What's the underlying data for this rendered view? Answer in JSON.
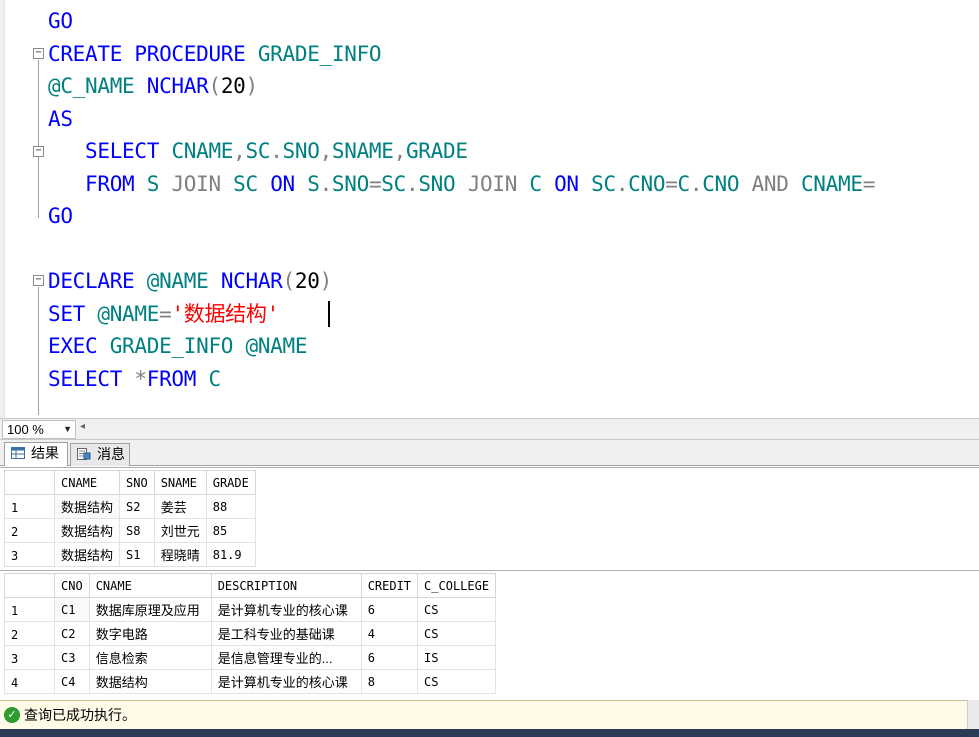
{
  "editor": {
    "lines": [
      {
        "tokens": [
          {
            "t": "GO",
            "c": "kw"
          }
        ]
      },
      {
        "tokens": [
          {
            "t": "CREATE PROCEDURE ",
            "c": "kw"
          },
          {
            "t": "GRADE_INFO",
            "c": "ob"
          }
        ]
      },
      {
        "tokens": [
          {
            "t": "@C_NAME ",
            "c": "var"
          },
          {
            "t": "NCHAR",
            "c": "kw"
          },
          {
            "t": "(",
            "c": "gy"
          },
          {
            "t": "20",
            "c": "bk"
          },
          {
            "t": ")",
            "c": "gy"
          }
        ]
      },
      {
        "tokens": [
          {
            "t": "AS",
            "c": "kw"
          }
        ]
      },
      {
        "tokens": [
          {
            "t": "   SELECT ",
            "c": "kw"
          },
          {
            "t": "CNAME",
            "c": "ob"
          },
          {
            "t": ",",
            "c": "gy"
          },
          {
            "t": "SC",
            "c": "ob"
          },
          {
            "t": ".",
            "c": "gy"
          },
          {
            "t": "SNO",
            "c": "ob"
          },
          {
            "t": ",",
            "c": "gy"
          },
          {
            "t": "SNAME",
            "c": "ob"
          },
          {
            "t": ",",
            "c": "gy"
          },
          {
            "t": "GRADE",
            "c": "ob"
          }
        ]
      },
      {
        "tokens": [
          {
            "t": "   FROM ",
            "c": "kw"
          },
          {
            "t": "S ",
            "c": "ob"
          },
          {
            "t": "JOIN ",
            "c": "gy"
          },
          {
            "t": "SC ",
            "c": "ob"
          },
          {
            "t": "ON ",
            "c": "kw"
          },
          {
            "t": "S",
            "c": "ob"
          },
          {
            "t": ".",
            "c": "gy"
          },
          {
            "t": "SNO",
            "c": "ob"
          },
          {
            "t": "=",
            "c": "gy"
          },
          {
            "t": "SC",
            "c": "ob"
          },
          {
            "t": ".",
            "c": "gy"
          },
          {
            "t": "SNO ",
            "c": "ob"
          },
          {
            "t": "JOIN ",
            "c": "gy"
          },
          {
            "t": "C ",
            "c": "ob"
          },
          {
            "t": "ON ",
            "c": "kw"
          },
          {
            "t": "SC",
            "c": "ob"
          },
          {
            "t": ".",
            "c": "gy"
          },
          {
            "t": "CNO",
            "c": "ob"
          },
          {
            "t": "=",
            "c": "gy"
          },
          {
            "t": "C",
            "c": "ob"
          },
          {
            "t": ".",
            "c": "gy"
          },
          {
            "t": "CNO ",
            "c": "ob"
          },
          {
            "t": "AND ",
            "c": "gy"
          },
          {
            "t": "CNAME",
            "c": "ob"
          },
          {
            "t": "=",
            "c": "gy"
          }
        ]
      },
      {
        "tokens": [
          {
            "t": "GO",
            "c": "kw"
          }
        ]
      },
      {
        "tokens": []
      },
      {
        "tokens": [
          {
            "t": "DECLARE ",
            "c": "kw"
          },
          {
            "t": "@NAME ",
            "c": "var"
          },
          {
            "t": "NCHAR",
            "c": "kw"
          },
          {
            "t": "(",
            "c": "gy"
          },
          {
            "t": "20",
            "c": "bk"
          },
          {
            "t": ")",
            "c": "gy"
          }
        ]
      },
      {
        "tokens": [
          {
            "t": "SET ",
            "c": "kw"
          },
          {
            "t": "@NAME",
            "c": "var"
          },
          {
            "t": "=",
            "c": "gy"
          },
          {
            "t": "'数据结构'",
            "c": "str"
          }
        ]
      },
      {
        "tokens": [
          {
            "t": "EXEC ",
            "c": "kw"
          },
          {
            "t": "GRADE_INFO ",
            "c": "ob"
          },
          {
            "t": "@NAME",
            "c": "var"
          }
        ]
      },
      {
        "tokens": [
          {
            "t": "SELECT ",
            "c": "kw"
          },
          {
            "t": "*",
            "c": "gy"
          },
          {
            "t": "FROM ",
            "c": "kw"
          },
          {
            "t": "C",
            "c": "ob"
          }
        ]
      }
    ]
  },
  "zoom": {
    "value": "100 %"
  },
  "tabs": {
    "results": "结果",
    "messages": "消息"
  },
  "grid1": {
    "columns": [
      "CNAME",
      "SNO",
      "SNAME",
      "GRADE"
    ],
    "rows": [
      {
        "n": "1",
        "cells": [
          "数据结构",
          "S2",
          "姜芸",
          "88"
        ]
      },
      {
        "n": "2",
        "cells": [
          "数据结构",
          "S8",
          "刘世元",
          "85"
        ]
      },
      {
        "n": "3",
        "cells": [
          "数据结构",
          "S1",
          "程晓晴",
          "81.9"
        ]
      }
    ]
  },
  "grid2": {
    "columns": [
      "CNO",
      "CNAME",
      "DESCRIPTION",
      "CREDIT",
      "C_COLLEGE"
    ],
    "rows": [
      {
        "n": "1",
        "cells": [
          "C1",
          "数据库原理及应用",
          "是计算机专业的核心课",
          "6",
          "CS"
        ]
      },
      {
        "n": "2",
        "cells": [
          "C2",
          "数字电路",
          "是工科专业的基础课",
          "4",
          "CS"
        ]
      },
      {
        "n": "3",
        "cells": [
          "C3",
          "信息检索",
          "是信息管理专业的...",
          "6",
          "IS"
        ]
      },
      {
        "n": "4",
        "cells": [
          "C4",
          "数据结构",
          "是计算机专业的核心课",
          "8",
          "CS"
        ]
      }
    ]
  },
  "status": {
    "text": "查询已成功执行。"
  },
  "colors": {
    "keyword": "#0000ff",
    "object": "#008080",
    "string": "#ff0000",
    "operator": "#808080",
    "status_bg": "#fffbe6"
  }
}
